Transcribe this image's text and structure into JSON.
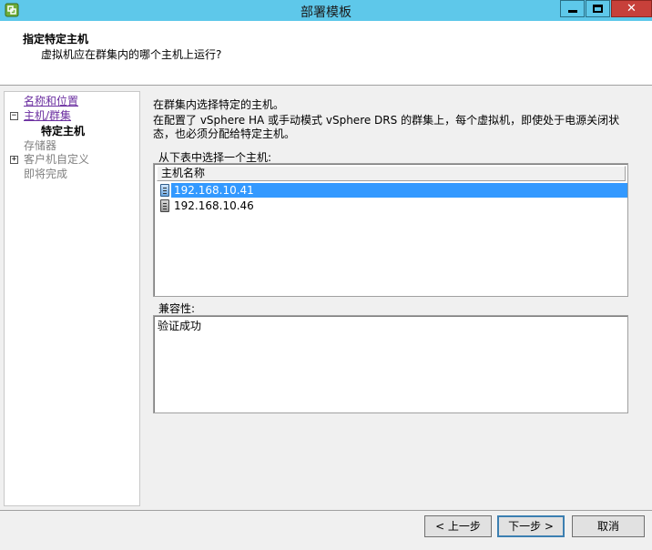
{
  "window": {
    "title": "部署模板",
    "app_icon": "vsphere-logo-icon",
    "minimize_icon": "minimize-icon",
    "maximize_icon": "maximize-icon",
    "close_icon": "close-icon",
    "close_glyph": "✕"
  },
  "header": {
    "title": "指定特定主机",
    "subtitle": "虚拟机应在群集内的哪个主机上运行?"
  },
  "nav": {
    "items": [
      {
        "label": "名称和位置",
        "state": "link"
      },
      {
        "label": "主机/群集",
        "state": "link",
        "expander": "⊟"
      },
      {
        "label": "特定主机",
        "state": "current"
      },
      {
        "label": "存储器",
        "state": "disabled"
      },
      {
        "label": "客户机自定义",
        "state": "disabled",
        "expander": "⊞"
      },
      {
        "label": "即将完成",
        "state": "disabled"
      }
    ],
    "expander_minus": "−",
    "expander_plus": "+"
  },
  "main": {
    "intro_line1": "在群集内选择特定的主机。",
    "intro_line2": "在配置了 vSphere HA 或手动模式 vSphere DRS 的群集上，每个虚拟机，即使处于电源关闭状态，也必须分配给特定主机。",
    "list_label": "从下表中选择一个主机:",
    "column_header": "主机名称",
    "hosts": [
      {
        "name": "192.168.10.41",
        "selected": true,
        "icon": "server-icon"
      },
      {
        "name": "192.168.10.46",
        "selected": false,
        "icon": "server-icon"
      }
    ],
    "compat_label": "兼容性:",
    "compat_text": "验证成功"
  },
  "buttons": {
    "back": "< 上一步",
    "next": "下一步 >",
    "cancel": "取消"
  },
  "colors": {
    "titlebar": "#5ec8ea",
    "close_button": "#c7403a",
    "selection": "#3399ff",
    "link": "#6b2fa0"
  }
}
